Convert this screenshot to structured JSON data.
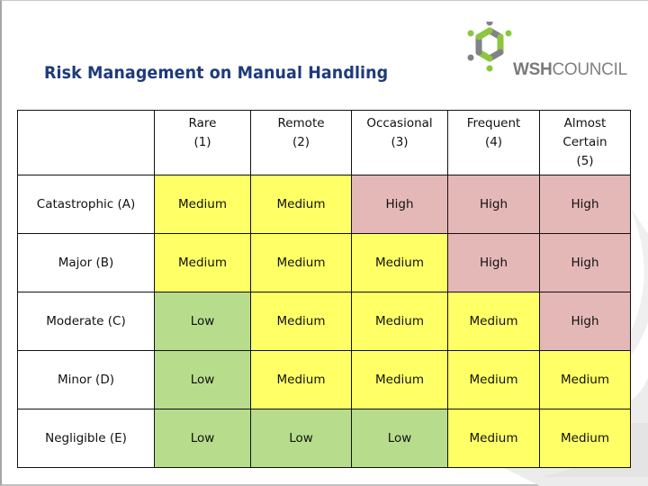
{
  "title": "Risk Management on Manual Handling",
  "logo": {
    "bold": "WSH",
    "regular": "COUNCIL",
    "green": "#8cc63f",
    "grey": "#808285"
  },
  "colors": {
    "Low": "#b7dd8c",
    "Medium": "#ffff66",
    "High": "#e5b8b8"
  },
  "matrix": {
    "corner": "",
    "likelihood": [
      {
        "lines": [
          "Rare",
          "(1)"
        ]
      },
      {
        "lines": [
          "Remote",
          "(2)"
        ]
      },
      {
        "lines": [
          "Occasional",
          "(3)"
        ]
      },
      {
        "lines": [
          "Frequent",
          "(4)"
        ]
      },
      {
        "lines": [
          "Almost",
          "Certain",
          "(5)"
        ]
      }
    ],
    "rows": [
      {
        "severity": "Catastrophic (A)",
        "cells": [
          "Medium",
          "Medium",
          "High",
          "High",
          "High"
        ]
      },
      {
        "severity": "Major (B)",
        "cells": [
          "Medium",
          "Medium",
          "Medium",
          "High",
          "High"
        ]
      },
      {
        "severity": "Moderate (C)",
        "cells": [
          "Low",
          "Medium",
          "Medium",
          "Medium",
          "High"
        ]
      },
      {
        "severity": "Minor (D)",
        "cells": [
          "Low",
          "Medium",
          "Medium",
          "Medium",
          "Medium"
        ]
      },
      {
        "severity": "Negligible (E)",
        "cells": [
          "Low",
          "Low",
          "Low",
          "Medium",
          "Medium"
        ]
      }
    ]
  }
}
